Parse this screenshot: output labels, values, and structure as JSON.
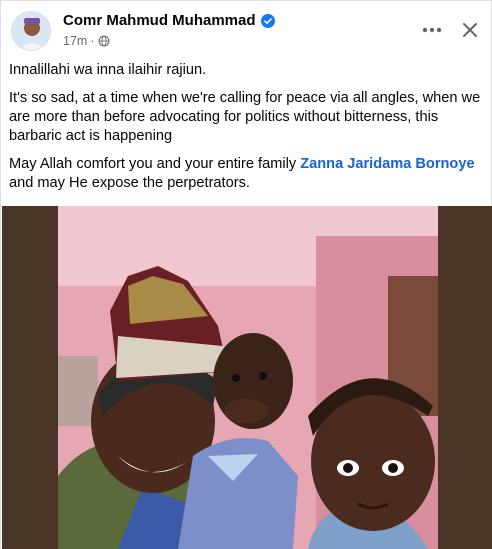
{
  "post": {
    "author": "Comr Mahmud Muhammad",
    "time": "17m",
    "separator": "·",
    "paragraphs": {
      "p1": "Innalillahi wa inna ilaihir rajiun.",
      "p2": "It's so sad, at a time when we're calling for peace via all angles, when we are more than before advocating for politics without bitterness, this barbaric act is happening",
      "p3_before": "May Allah comfort you and your entire family ",
      "p3_mention": "Zanna Jaridama Bornoye",
      "p3_after": " and may He expose the perpetrators."
    }
  },
  "icons": {
    "verified": "verified-badge-icon",
    "privacy": "globe-icon",
    "more": "more-options-icon",
    "close": "close-icon"
  },
  "colors": {
    "mention": "#1664d2",
    "meta": "#65676b",
    "verified": "#1877f2",
    "photo_frame": "#4b3526"
  }
}
